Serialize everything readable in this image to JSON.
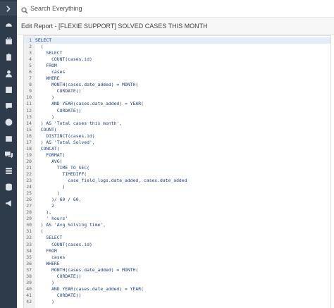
{
  "search": {
    "placeholder": "Search Everything"
  },
  "page_title": "Edit Report - [FLEXIE SUPPORT] SOLVED CASES THIS MONTH",
  "sidebar": {
    "items": [
      {
        "icon": "chevron-right-icon"
      },
      {
        "icon": "dashboard-icon"
      },
      {
        "icon": "calendar-icon"
      },
      {
        "icon": "clipboard-icon"
      },
      {
        "icon": "user-icon"
      },
      {
        "icon": "contacts-icon"
      },
      {
        "icon": "chat-icon"
      },
      {
        "icon": "close-circle-icon"
      },
      {
        "icon": "calendar-check-icon"
      },
      {
        "icon": "messages-icon"
      },
      {
        "icon": "list-icon"
      },
      {
        "icon": "database-icon"
      },
      {
        "icon": "announcement-icon"
      }
    ]
  },
  "editor": {
    "lines": [
      {
        "n": "1",
        "t": "SELECT"
      },
      {
        "n": "2",
        "t": "  ("
      },
      {
        "n": "3",
        "t": "    SELECT"
      },
      {
        "n": "4",
        "t": "      COUNT(cases.id)"
      },
      {
        "n": "5",
        "t": "    FROM"
      },
      {
        "n": "6",
        "t": "      cases"
      },
      {
        "n": "7",
        "t": "    WHERE"
      },
      {
        "n": "8",
        "t": "      MONTH(cases.date_added) = MONTH("
      },
      {
        "n": "9",
        "t": "        CURDATE()"
      },
      {
        "n": "10",
        "t": "      )"
      },
      {
        "n": "11",
        "t": "      AND YEAR(cases.date_added) = YEAR("
      },
      {
        "n": "12",
        "t": "        CURDATE()"
      },
      {
        "n": "13",
        "t": "      )"
      },
      {
        "n": "14",
        "t": "  ) AS 'Total cases this month',"
      },
      {
        "n": "15",
        "t": "  COUNT("
      },
      {
        "n": "16",
        "t": "    DISTINCT(cases.id)"
      },
      {
        "n": "17",
        "t": "  ) AS 'Total Solved',"
      },
      {
        "n": "18",
        "t": "  CONCAT("
      },
      {
        "n": "19",
        "t": "    FORMAT("
      },
      {
        "n": "20",
        "t": "      AVG("
      },
      {
        "n": "21",
        "t": "        TIME_TO_SEC("
      },
      {
        "n": "22",
        "t": "          TIMEDIFF("
      },
      {
        "n": "23",
        "t": "            case_field_logs.date_added, cases.date_added"
      },
      {
        "n": "24",
        "t": "          )"
      },
      {
        "n": "25",
        "t": "        )"
      },
      {
        "n": "26",
        "t": "      )/ 60 / 60,"
      },
      {
        "n": "27",
        "t": "      2"
      },
      {
        "n": "28",
        "t": "    ),"
      },
      {
        "n": "29",
        "t": "    ' hours'"
      },
      {
        "n": "30",
        "t": "  ) AS 'Avg Solving time',"
      },
      {
        "n": "31",
        "t": "  ("
      },
      {
        "n": "32",
        "t": "    SELECT"
      },
      {
        "n": "33",
        "t": "      COUNT(cases.id)"
      },
      {
        "n": "34",
        "t": "    FROM"
      },
      {
        "n": "35",
        "t": "      cases"
      },
      {
        "n": "36",
        "t": "    WHERE"
      },
      {
        "n": "37",
        "t": "      MONTH(cases.date_added) = MONTH("
      },
      {
        "n": "38",
        "t": "        CURDATE()"
      },
      {
        "n": "39",
        "t": "      )"
      },
      {
        "n": "40",
        "t": "      AND YEAR(cases.date_added) = YEAR("
      },
      {
        "n": "41",
        "t": "        CURDATE()"
      },
      {
        "n": "42",
        "t": "      )"
      }
    ]
  },
  "colors": {
    "sidebar_bg": "#2e3b4a",
    "code_text": "#1f3f7a",
    "active_line": "#e4ecf8"
  }
}
